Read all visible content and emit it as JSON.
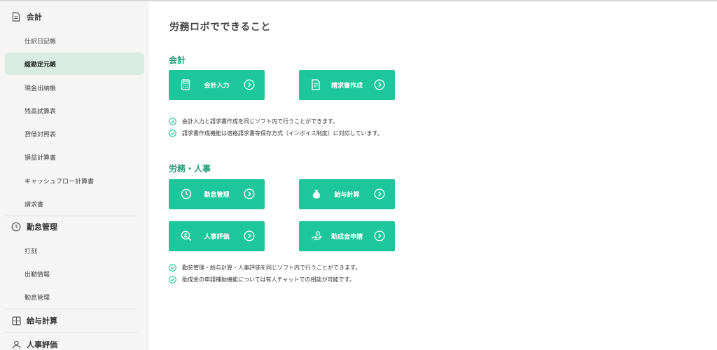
{
  "sidebar": {
    "sections": [
      {
        "label": "会計",
        "icon": "document-icon"
      },
      {
        "label": "勤怠管理",
        "icon": "clock-icon"
      },
      {
        "label": "給与計算",
        "icon": "calculator-grid-icon"
      },
      {
        "label": "人事評価",
        "icon": "person-icon"
      }
    ],
    "accounting_items": [
      "仕訳日記帳",
      "総勘定元帳",
      "現金出納帳",
      "残高試算表",
      "貸借対照表",
      "損益計算書",
      "キャッシュフロー計算書",
      "請求書"
    ],
    "attendance_items": [
      "打刻",
      "出勤情報",
      "勤怠管理"
    ],
    "active_item": "総勘定元帳"
  },
  "main": {
    "title": "労務ロボでできること",
    "accounting": {
      "title": "会計",
      "buttons": [
        {
          "label": "会計入力",
          "icon": "calculator-icon"
        },
        {
          "label": "請求書作成",
          "icon": "invoice-icon"
        }
      ],
      "notes": [
        "会計入力と請求書作成を同じソフト内で行うことができます。",
        "請求書作成機能は適格請求書等保存方式（インボイス制度）に対応しています。"
      ]
    },
    "hr": {
      "title": "労務・人事",
      "buttons": [
        {
          "label": "勤怠管理",
          "icon": "clock-icon"
        },
        {
          "label": "給与計算",
          "icon": "money-bag-icon"
        },
        {
          "label": "人事評価",
          "icon": "person-search-icon"
        },
        {
          "label": "助成金申請",
          "icon": "hand-coin-icon"
        }
      ],
      "notes": [
        "勤怠管理・給与計算・人事評価を同じソフト内で行うことができます。",
        "助成金の申請補助機能については有人チャットでの相談が可能です。"
      ]
    }
  },
  "colors": {
    "accent": "#1ec79b",
    "section_title": "#1f9c77",
    "active_bg": "#d8ece2",
    "sidebar_bg": "#f5f5f5"
  }
}
